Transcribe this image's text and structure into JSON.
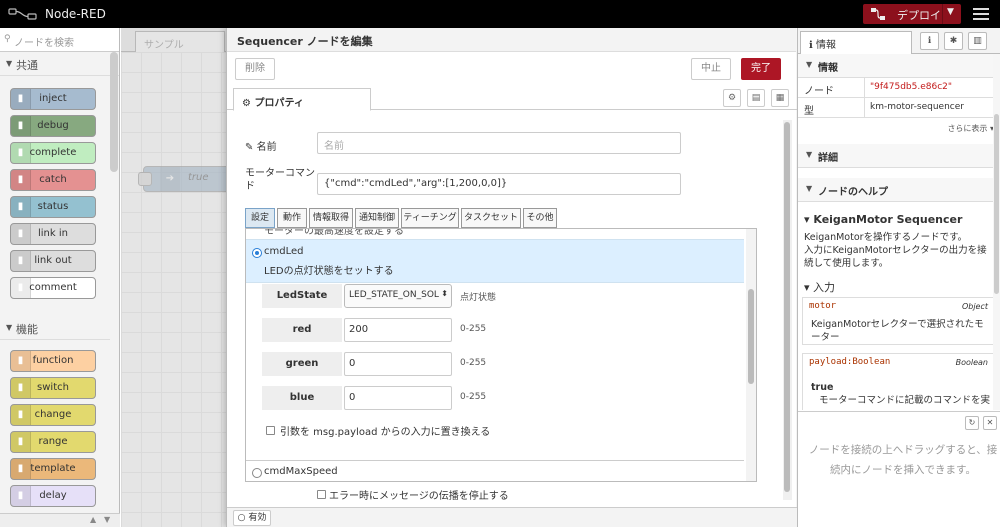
{
  "header": {
    "title": "Node-RED",
    "deploy_label": "デプロイ"
  },
  "palette": {
    "search_placeholder": "ノードを検索",
    "categories": [
      {
        "label": "共通"
      },
      {
        "label": "機能"
      }
    ],
    "common_nodes": [
      {
        "label": "inject",
        "color": "#a6bbcf"
      },
      {
        "label": "debug",
        "color": "#87a980"
      },
      {
        "label": "complete",
        "color": "#c0edc0"
      },
      {
        "label": "catch",
        "color": "#e49191"
      },
      {
        "label": "status",
        "color": "#94c1d0"
      },
      {
        "label": "link in",
        "color": "#dddddd"
      },
      {
        "label": "link out",
        "color": "#dddddd"
      },
      {
        "label": "comment",
        "color": "#ffffff"
      }
    ],
    "function_nodes": [
      {
        "label": "function",
        "color": "#fdd0a2"
      },
      {
        "label": "switch",
        "color": "#e2d96e"
      },
      {
        "label": "change",
        "color": "#e2d96e"
      },
      {
        "label": "range",
        "color": "#e2d96e"
      },
      {
        "label": "template",
        "color": "#ebb87a"
      },
      {
        "label": "delay",
        "color": "#e6e0f8"
      }
    ]
  },
  "workspace": {
    "tab_label": "サンプル",
    "node_label": "true"
  },
  "editor": {
    "title": "Sequencer ノードを編集",
    "delete_label": "削除",
    "cancel_label": "中止",
    "done_label": "完了",
    "properties_tab": "プロパティ",
    "name_label": "名前",
    "name_placeholder": "名前",
    "command_label": "モーターコマンド",
    "command_value": "{\"cmd\":\"cmdLed\",\"arg\":[1,200,0,0]}",
    "sub_tabs": [
      "設定",
      "動作",
      "情報取得",
      "通知制御",
      "ティーチング",
      "タスクセット",
      "その他"
    ],
    "cut_text": "モーターの最高速度を設定する",
    "selected_cmd": "cmdLed",
    "selected_desc": "LEDの点灯状態をセットする",
    "params": [
      {
        "label": "LedState",
        "value": "LED_STATE_ON_SOL",
        "range": "点灯状態"
      },
      {
        "label": "red",
        "value": "200",
        "range": "0-255"
      },
      {
        "label": "green",
        "value": "0",
        "range": "0-255"
      },
      {
        "label": "blue",
        "value": "0",
        "range": "0-255"
      }
    ],
    "payload_checkbox": "引数を msg.payload からの入力に置き換える",
    "next_cmd": "cmdMaxSpeed",
    "error_checkbox": "エラー時にメッセージの伝播を停止する",
    "enable_label": "有効"
  },
  "sidebar": {
    "tab_label": "情報",
    "info_section": "情報",
    "node_key": "ノード",
    "node_value": "\"9f475db5.e86c2\"",
    "type_key": "型",
    "type_value": "km-motor-sequencer",
    "more_label": "さらに表示 ▾",
    "detail_section": "詳細",
    "help_section": "ノードのヘルプ",
    "help_title": "KeiganMotor Sequencer",
    "help_text1": "KeiganMotorを操作するノードです。",
    "help_text2": "入力にKeiganMotorセレクターの出力を接続して使用します。",
    "input_heading": "入力",
    "prop1_name": "motor",
    "prop1_type": "Object",
    "prop1_desc": "KeiganMotorセレクターで選択されたモーター",
    "prop2_name": "payload:Boolean",
    "prop2_type": "Boolean",
    "prop2_sub": "true",
    "prop2_desc": "モーターコマンドに記載のコマンドを実",
    "bottom_hint": "ノードを接続の上へドラッグすると、接続内にノードを挿入できます。"
  }
}
